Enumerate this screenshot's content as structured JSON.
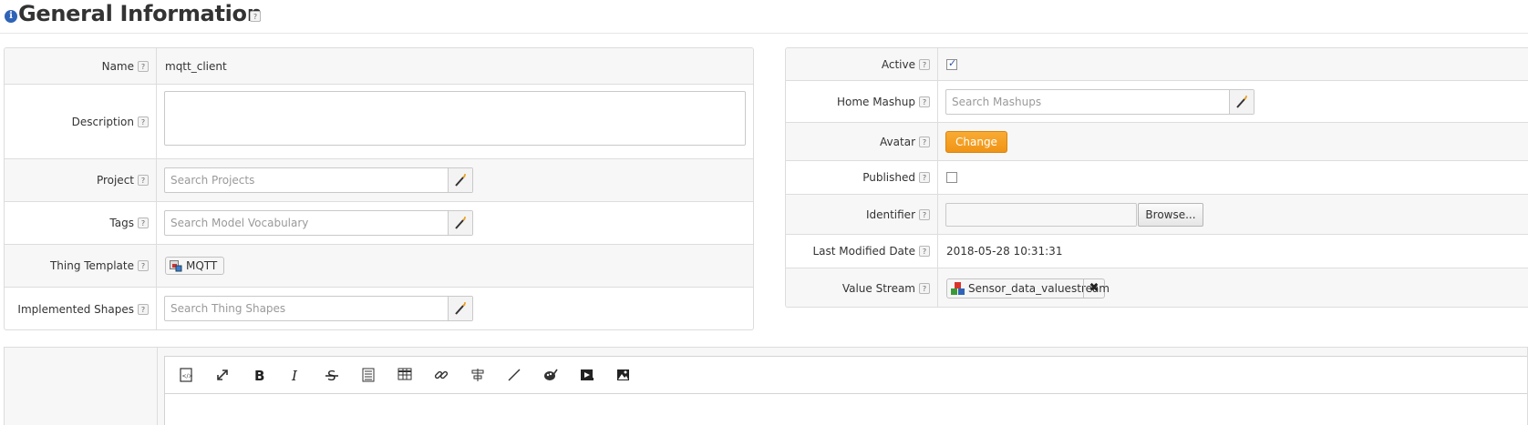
{
  "header": {
    "title": "General Information",
    "help": "?"
  },
  "left_panel": {
    "name": {
      "label": "Name",
      "value": "mqtt_client"
    },
    "description": {
      "label": "Description",
      "value": ""
    },
    "project": {
      "label": "Project",
      "placeholder": "Search Projects"
    },
    "tags": {
      "label": "Tags",
      "placeholder": "Search Model Vocabulary"
    },
    "thing_template": {
      "label": "Thing Template",
      "value": "MQTT"
    },
    "implemented_shapes": {
      "label": "Implemented Shapes",
      "placeholder": "Search Thing Shapes"
    }
  },
  "right_panel": {
    "active": {
      "label": "Active",
      "checked": true
    },
    "home_mashup": {
      "label": "Home Mashup",
      "placeholder": "Search Mashups"
    },
    "avatar": {
      "label": "Avatar",
      "button": "Change"
    },
    "published": {
      "label": "Published",
      "checked": false
    },
    "identifier": {
      "label": "Identifier",
      "value": "",
      "button": "Browse..."
    },
    "last_modified": {
      "label": "Last Modified Date",
      "value": "2018-05-28 10:31:31"
    },
    "value_stream": {
      "label": "Value Stream",
      "value": "Sensor_data_valuestream",
      "remove": "✖"
    }
  },
  "colors": {
    "accent_orange": "#f09416",
    "info_blue": "#2f63b7",
    "check_blue": "#2b53a8"
  },
  "editor_toolbar": [
    "source-code-icon",
    "fullscreen-icon",
    "bold-icon",
    "italic-icon",
    "strikethrough-icon",
    "list-icon",
    "table-icon",
    "link-icon",
    "align-icon",
    "horizontal-line-icon",
    "color-palette-icon",
    "video-icon",
    "image-icon"
  ]
}
